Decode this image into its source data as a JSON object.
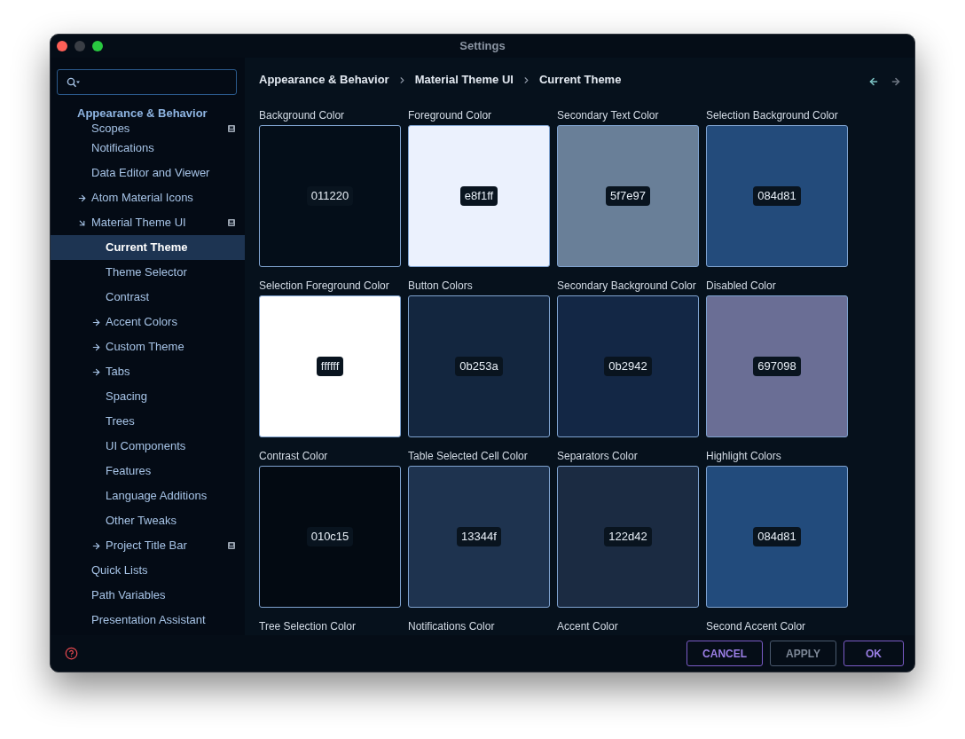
{
  "window": {
    "title": "Settings"
  },
  "sidebar": {
    "section": "Appearance & Behavior",
    "items": [
      {
        "label": "Scopes",
        "selected": false,
        "badge": true
      },
      {
        "label": "Notifications",
        "selected": false,
        "badge": false
      },
      {
        "label": "Data Editor and Viewer",
        "selected": false,
        "badge": false
      },
      {
        "label": "Atom Material Icons",
        "selected": false,
        "badge": false,
        "expanded": false
      },
      {
        "label": "Material Theme UI",
        "selected": false,
        "badge": true,
        "expanded": true,
        "children": [
          {
            "label": "Current Theme",
            "selected": true,
            "badge": false
          },
          {
            "label": "Theme Selector",
            "selected": false,
            "badge": false
          },
          {
            "label": "Contrast",
            "selected": false,
            "badge": false
          },
          {
            "label": "Accent Colors",
            "selected": false,
            "badge": false,
            "expanded": false
          },
          {
            "label": "Custom Theme",
            "selected": false,
            "badge": false,
            "expanded": false
          },
          {
            "label": "Tabs",
            "selected": false,
            "badge": false,
            "expanded": false
          },
          {
            "label": "Spacing",
            "selected": false,
            "badge": false
          },
          {
            "label": "Trees",
            "selected": false,
            "badge": false
          },
          {
            "label": "UI Components",
            "selected": false,
            "badge": false
          },
          {
            "label": "Features",
            "selected": false,
            "badge": false
          },
          {
            "label": "Language Additions",
            "selected": false,
            "badge": false
          },
          {
            "label": "Other Tweaks",
            "selected": false,
            "badge": false
          },
          {
            "label": "Project Title Bar",
            "selected": false,
            "badge": true,
            "expanded": false
          }
        ]
      },
      {
        "label": "Quick Lists",
        "selected": false,
        "badge": false
      },
      {
        "label": "Path Variables",
        "selected": false,
        "badge": false
      },
      {
        "label": "Presentation Assistant",
        "selected": false,
        "badge": false
      }
    ]
  },
  "breadcrumb": [
    "Appearance & Behavior",
    "Material Theme UI",
    "Current Theme"
  ],
  "nav": {
    "back": {
      "disabled": false
    },
    "forward": {
      "disabled": true
    }
  },
  "swatches": [
    {
      "label": "Background Color",
      "hex": "011220",
      "color": "#040e19"
    },
    {
      "label": "Foreground Color",
      "hex": "e8f1ff",
      "color": "#ebf1fd"
    },
    {
      "label": "Secondary Text Color",
      "hex": "5f7e97",
      "color": "#697f98"
    },
    {
      "label": "Selection Background Color",
      "hex": "084d81",
      "color": "#234b7b"
    },
    {
      "label": "Selection Foreground Color",
      "hex": "ffffff",
      "color": "#ffffff"
    },
    {
      "label": "Button Colors",
      "hex": "0b253a",
      "color": "#13263f"
    },
    {
      "label": "Secondary Background Color",
      "hex": "0b2942",
      "color": "#132745"
    },
    {
      "label": "Disabled Color",
      "hex": "697098",
      "color": "#6a6e95"
    },
    {
      "label": "Contrast Color",
      "hex": "010c15",
      "color": "#030a12"
    },
    {
      "label": "Table Selected Cell Color",
      "hex": "13344f",
      "color": "#1e334f"
    },
    {
      "label": "Separators Color",
      "hex": "122d42",
      "color": "#1b2b42"
    },
    {
      "label": "Highlight Colors",
      "hex": "084d81",
      "color": "#224b7c"
    },
    {
      "label": "Tree Selection Color"
    },
    {
      "label": "Notifications Color"
    },
    {
      "label": "Accent Color"
    },
    {
      "label": "Second Accent Color"
    }
  ],
  "footer": {
    "buttons": [
      {
        "label": "CANCEL",
        "disabled": false
      },
      {
        "label": "APPLY",
        "disabled": true
      },
      {
        "label": "OK",
        "disabled": false
      }
    ]
  }
}
